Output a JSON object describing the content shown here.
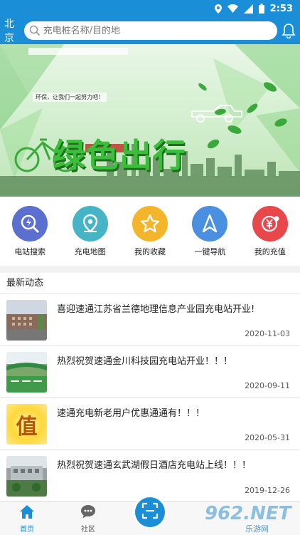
{
  "status_bar": {
    "time": "2:53"
  },
  "header": {
    "city": "北京",
    "search_placeholder": "充电桩名称/目的地"
  },
  "banner": {
    "title": "绿色出行",
    "subtitle": "环保，让我们一起努力吧！"
  },
  "quick_actions": [
    {
      "label": "电站搜索",
      "icon": "station-search-icon",
      "color": "#5b6fcf"
    },
    {
      "label": "充电地图",
      "icon": "map-pin-icon",
      "color": "#47b4c6"
    },
    {
      "label": "我的收藏",
      "icon": "star-icon",
      "color": "#f3b52a"
    },
    {
      "label": "一键导航",
      "icon": "navigation-icon",
      "color": "#4a8fe0"
    },
    {
      "label": "我的充值",
      "icon": "yuan-icon",
      "color": "#e8474b"
    }
  ],
  "news": {
    "title": "最新动态",
    "items": [
      {
        "title": "喜迎速通江苏省兰德地理信息产业园充电站开业!",
        "date": "2020-11-03"
      },
      {
        "title": "热烈祝贺速通金川科技园充电站开业！！！",
        "date": "2020-09-11"
      },
      {
        "title": "速通充电新老用户优惠通通有！！！",
        "date": "2020-05-31",
        "thumb_text": "值"
      },
      {
        "title": "热烈祝贺速通玄武湖假日酒店充电站上线！！！",
        "date": "2019-12-26"
      }
    ]
  },
  "tabbar": {
    "home": "首页",
    "community": "社区"
  },
  "watermark": {
    "main": "962.NET",
    "sub": "乐游网"
  },
  "colors": {
    "primary": "#1a8fd8",
    "banner_green": "#3bbf3b"
  }
}
